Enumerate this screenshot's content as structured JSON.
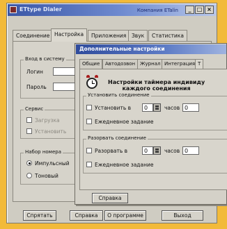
{
  "window": {
    "title": "ETtype Dialer",
    "brand": "Компания ETalin",
    "controls": {
      "minimize": "_",
      "maximize": "□",
      "close": "×"
    }
  },
  "tabs": [
    "Соединение",
    "Настройка",
    "Приложения",
    "Звук",
    "Статистика"
  ],
  "settings": {
    "login_group": {
      "title": "Вход в систему",
      "login_label": "Логин",
      "password_label": "Пароль"
    },
    "service_group": {
      "title": "Сервис",
      "opt1": "Загрузка",
      "opt2": "Установить"
    },
    "dial_group": {
      "title": "Набор номера",
      "opt_pulse": "Импульсный",
      "opt_tone": "Тоновый"
    }
  },
  "bottom_buttons": {
    "hide": "Спрятать",
    "help": "Справка",
    "about": "О программе",
    "exit": "Выход"
  },
  "dialog": {
    "title": "Дополнительные настройки",
    "tabs": [
      "Общие",
      "Автодозвон",
      "Журнал",
      "Интеграция",
      "Т"
    ],
    "heading_line1": "Настройки таймера индивиду",
    "heading_line2": "каждого соединения",
    "connect_group": {
      "title": "Установить соединение",
      "set_label": "Установить в",
      "hours_value": "0",
      "hours_unit": "часов",
      "minutes_value": "0",
      "daily_label": "Ежедневное задание"
    },
    "disconnect_group": {
      "title": "Разорвать соединение",
      "set_label": "Разорвать в",
      "hours_value": "0",
      "hours_unit": "часов",
      "minutes_value": "0",
      "daily_label": "Ежедневное задание"
    },
    "help_button": "Справка"
  }
}
